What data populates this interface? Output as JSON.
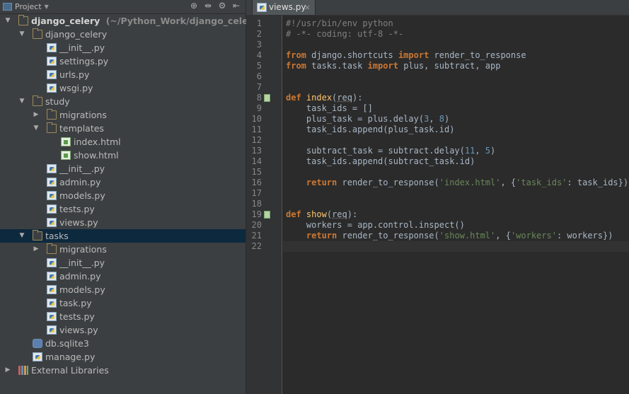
{
  "project_toolbar": {
    "title": "Project",
    "icons": [
      "target-icon",
      "split-icon",
      "gear-icon",
      "collapse-icon"
    ]
  },
  "tree": [
    {
      "depth": 0,
      "arrow": "down",
      "icon": "folder",
      "label": "django_celery",
      "hint": "(~/Python_Work/django_celery)",
      "bold": true
    },
    {
      "depth": 1,
      "arrow": "down",
      "icon": "folder",
      "label": "django_celery"
    },
    {
      "depth": 2,
      "icon": "py",
      "label": "__init__.py"
    },
    {
      "depth": 2,
      "icon": "py",
      "label": "settings.py"
    },
    {
      "depth": 2,
      "icon": "py",
      "label": "urls.py"
    },
    {
      "depth": 2,
      "icon": "py",
      "label": "wsgi.py"
    },
    {
      "depth": 1,
      "arrow": "down",
      "icon": "folder",
      "label": "study"
    },
    {
      "depth": 2,
      "arrow": "right",
      "icon": "folder",
      "label": "migrations"
    },
    {
      "depth": 2,
      "arrow": "down",
      "icon": "folder",
      "label": "templates"
    },
    {
      "depth": 3,
      "icon": "html",
      "label": "index.html"
    },
    {
      "depth": 3,
      "icon": "html",
      "label": "show.html"
    },
    {
      "depth": 2,
      "icon": "py",
      "label": "__init__.py"
    },
    {
      "depth": 2,
      "icon": "py",
      "label": "admin.py"
    },
    {
      "depth": 2,
      "icon": "py",
      "label": "models.py"
    },
    {
      "depth": 2,
      "icon": "py",
      "label": "tests.py"
    },
    {
      "depth": 2,
      "icon": "py",
      "label": "views.py"
    },
    {
      "depth": 1,
      "arrow": "down",
      "icon": "folder",
      "label": "tasks",
      "selected": true
    },
    {
      "depth": 2,
      "arrow": "right",
      "icon": "folder",
      "label": "migrations"
    },
    {
      "depth": 2,
      "icon": "py",
      "label": "__init__.py"
    },
    {
      "depth": 2,
      "icon": "py",
      "label": "admin.py"
    },
    {
      "depth": 2,
      "icon": "py",
      "label": "models.py"
    },
    {
      "depth": 2,
      "icon": "py",
      "label": "task.py"
    },
    {
      "depth": 2,
      "icon": "py",
      "label": "tests.py"
    },
    {
      "depth": 2,
      "icon": "py",
      "label": "views.py"
    },
    {
      "depth": 1,
      "icon": "db",
      "label": "db.sqlite3"
    },
    {
      "depth": 1,
      "icon": "py",
      "label": "manage.py"
    },
    {
      "depth": 0,
      "arrow": "right",
      "icon": "lib",
      "label": "External Libraries"
    }
  ],
  "editor": {
    "tab_title": "views.py",
    "tab_close": "×",
    "current_line": 22,
    "marked_lines": [
      8,
      19
    ],
    "colors": {
      "keyword": "#cc7832",
      "string": "#6a8759",
      "number": "#6897bb",
      "comment": "#808080",
      "text": "#a9b7c6",
      "func": "#ffc66d"
    },
    "lines": [
      [
        [
          "c",
          "#!/usr/bin/env python"
        ]
      ],
      [
        [
          "c",
          "# -*- coding: utf-8 -*-"
        ]
      ],
      [],
      [
        [
          "k",
          "from"
        ],
        [
          "t",
          " django.shortcuts "
        ],
        [
          "k",
          "import"
        ],
        [
          "t",
          " render_to_response"
        ]
      ],
      [
        [
          "k",
          "from"
        ],
        [
          "t",
          " tasks.task "
        ],
        [
          "k",
          "import"
        ],
        [
          "t",
          " plus, subtract, app"
        ]
      ],
      [],
      [],
      [
        [
          "k",
          "def"
        ],
        [
          "t",
          " "
        ],
        [
          "f",
          "index"
        ],
        [
          "t",
          "("
        ],
        [
          "p",
          "req"
        ],
        [
          "t",
          "):"
        ]
      ],
      [
        [
          "t",
          "    task_ids = []"
        ]
      ],
      [
        [
          "t",
          "    plus_task = plus.delay("
        ],
        [
          "n",
          "3"
        ],
        [
          "t",
          ", "
        ],
        [
          "n",
          "8"
        ],
        [
          "t",
          ")"
        ]
      ],
      [
        [
          "t",
          "    task_ids.append(plus_task.id)"
        ]
      ],
      [],
      [
        [
          "t",
          "    subtract_task = subtract.delay("
        ],
        [
          "n",
          "11"
        ],
        [
          "t",
          ", "
        ],
        [
          "n",
          "5"
        ],
        [
          "t",
          ")"
        ]
      ],
      [
        [
          "t",
          "    task_ids.append(subtract_task.id)"
        ]
      ],
      [],
      [
        [
          "t",
          "    "
        ],
        [
          "k",
          "return"
        ],
        [
          "t",
          " render_to_response("
        ],
        [
          "s",
          "'index.html'"
        ],
        [
          "t",
          ", {"
        ],
        [
          "s",
          "'task_ids'"
        ],
        [
          "t",
          ": task_ids})"
        ]
      ],
      [],
      [],
      [
        [
          "k",
          "def"
        ],
        [
          "t",
          " "
        ],
        [
          "f",
          "show"
        ],
        [
          "t",
          "("
        ],
        [
          "p",
          "req"
        ],
        [
          "t",
          "):"
        ]
      ],
      [
        [
          "t",
          "    workers = app.control.inspect()"
        ]
      ],
      [
        [
          "t",
          "    "
        ],
        [
          "k",
          "return"
        ],
        [
          "t",
          " render_to_response("
        ],
        [
          "s",
          "'show.html'"
        ],
        [
          "t",
          ", {"
        ],
        [
          "s",
          "'workers'"
        ],
        [
          "t",
          ": workers})"
        ]
      ],
      []
    ]
  }
}
